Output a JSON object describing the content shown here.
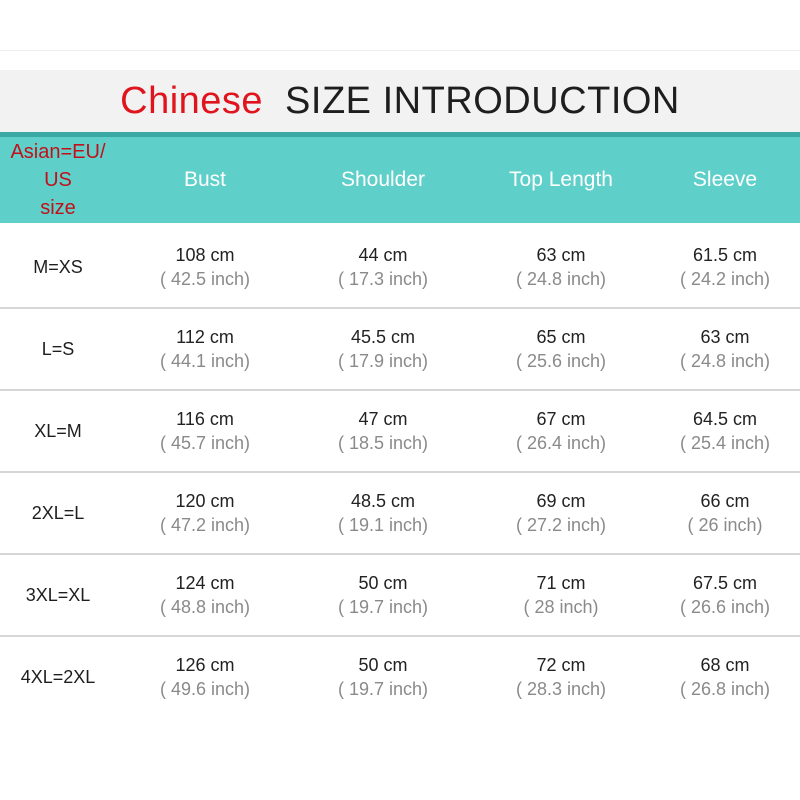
{
  "title": {
    "highlight": "Chinese",
    "main": "SIZE INTRODUCTION"
  },
  "headers": {
    "size_lines": [
      "Asian=EU/",
      "US",
      "size"
    ],
    "columns": [
      "Bust",
      "Shoulder",
      "Top Length",
      "Sleeve"
    ]
  },
  "rows": [
    {
      "size": "M=XS",
      "cells": [
        {
          "cm": "108 cm",
          "inch": "( 42.5 inch)"
        },
        {
          "cm": "44 cm",
          "inch": "( 17.3 inch)"
        },
        {
          "cm": "63 cm",
          "inch": "( 24.8 inch)"
        },
        {
          "cm": "61.5 cm",
          "inch": "( 24.2 inch)"
        }
      ]
    },
    {
      "size": "L=S",
      "cells": [
        {
          "cm": "112 cm",
          "inch": "( 44.1 inch)"
        },
        {
          "cm": "45.5 cm",
          "inch": "( 17.9 inch)"
        },
        {
          "cm": "65 cm",
          "inch": "( 25.6 inch)"
        },
        {
          "cm": "63 cm",
          "inch": "( 24.8 inch)"
        }
      ]
    },
    {
      "size": "XL=M",
      "cells": [
        {
          "cm": "116 cm",
          "inch": "( 45.7 inch)"
        },
        {
          "cm": "47 cm",
          "inch": "( 18.5 inch)"
        },
        {
          "cm": "67 cm",
          "inch": "( 26.4 inch)"
        },
        {
          "cm": "64.5 cm",
          "inch": "( 25.4 inch)"
        }
      ]
    },
    {
      "size": "2XL=L",
      "cells": [
        {
          "cm": "120 cm",
          "inch": "( 47.2 inch)"
        },
        {
          "cm": "48.5 cm",
          "inch": "( 19.1 inch)"
        },
        {
          "cm": "69 cm",
          "inch": "( 27.2 inch)"
        },
        {
          "cm": "66 cm",
          "inch": "( 26 inch)"
        }
      ]
    },
    {
      "size": "3XL=XL",
      "cells": [
        {
          "cm": "124 cm",
          "inch": "( 48.8 inch)"
        },
        {
          "cm": "50 cm",
          "inch": "( 19.7 inch)"
        },
        {
          "cm": "71 cm",
          "inch": "( 28 inch)"
        },
        {
          "cm": "67.5 cm",
          "inch": "( 26.6 inch)"
        }
      ]
    },
    {
      "size": "4XL=2XL",
      "cells": [
        {
          "cm": "126 cm",
          "inch": "( 49.6 inch)"
        },
        {
          "cm": "50 cm",
          "inch": "( 19.7 inch)"
        },
        {
          "cm": "72 cm",
          "inch": "( 28.3 inch)"
        },
        {
          "cm": "68 cm",
          "inch": "( 26.8 inch)"
        }
      ]
    }
  ],
  "colors": {
    "title_red": "#e0141c",
    "header_teal": "#5fcfc9",
    "accent_teal": "#3aa8a3",
    "size_header_red": "#c0111a"
  }
}
